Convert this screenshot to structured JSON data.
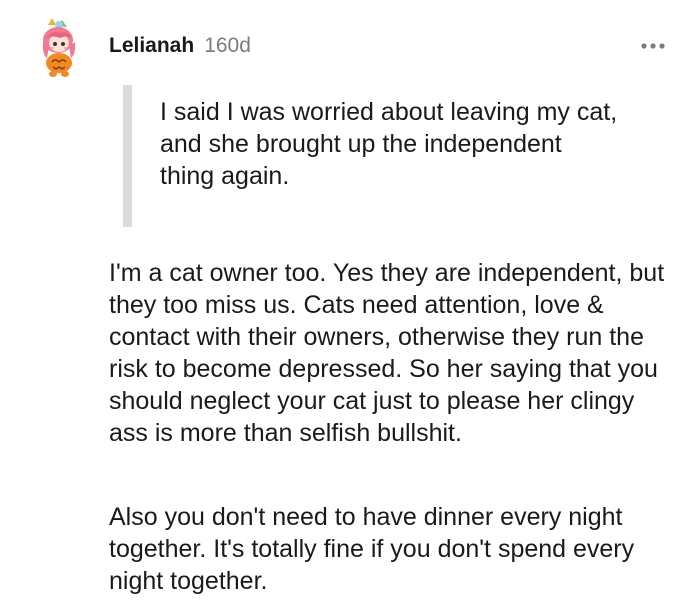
{
  "comment": {
    "username": "Lelianah",
    "age": "160d",
    "avatar_icon": "anime-cat-girl-avatar-icon",
    "more_icon": "ellipsis-horizontal-icon",
    "quote": "I said I was worried about leaving my cat, and she brought up the independent thing again.",
    "paragraphs": [
      "I'm a cat owner too. Yes they are independent, but they too miss us. Cats need attention, love & contact with their owners, otherwise they run the risk to become depressed. So her saying that you should neglect your cat just to please her clingy ass is more than selfish bullshit.",
      "Also you don't need to have dinner every night together. It's totally fine if you don't spend every night together."
    ]
  },
  "colors": {
    "text": "#1a1a1b",
    "muted": "#7c7c7c",
    "quote_bar": "#dcdcdc",
    "background": "#ffffff"
  }
}
